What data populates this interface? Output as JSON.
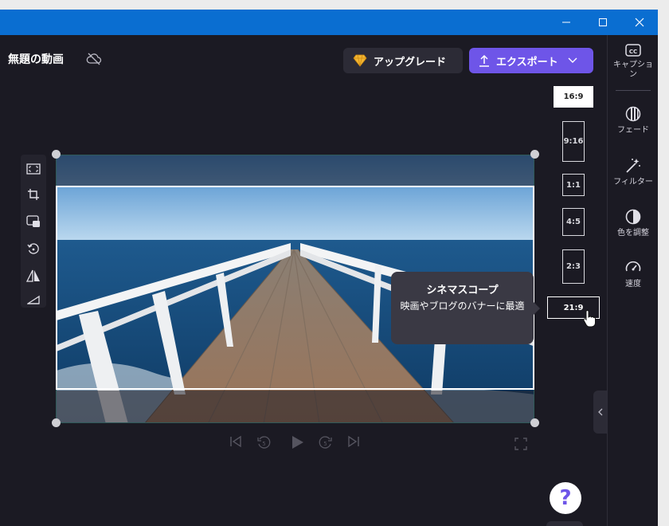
{
  "window": {
    "controls": [
      "minimize-icon",
      "maximize-icon",
      "close-icon"
    ]
  },
  "header": {
    "title": "無題の動画",
    "upgrade_label": "アップグレード",
    "export_label": "エクスポート",
    "accent_color": "#6e55e8"
  },
  "sidebar": {
    "items": [
      {
        "label": "キャプション",
        "icon": "captions-icon"
      },
      {
        "label": "フェード",
        "icon": "fade-icon"
      },
      {
        "label": "フィルター",
        "icon": "filter-wand-icon"
      },
      {
        "label": "色を調整",
        "icon": "color-adjust-icon"
      },
      {
        "label": "速度",
        "icon": "speed-gauge-icon"
      }
    ]
  },
  "aspect_ratios": {
    "options": [
      "16:9",
      "9:16",
      "1:1",
      "4:5",
      "2:3",
      "21:9"
    ],
    "selected": "16:9",
    "hovered": "21:9"
  },
  "tooltip": {
    "title": "シネマスコープ",
    "description": "映画やブログのバナーに最適"
  },
  "tools": [
    "fit-icon",
    "crop-icon",
    "picture-in-picture-icon",
    "rotate-icon",
    "flip-icon",
    "fade-corner-icon"
  ],
  "playback": [
    "skip-back-icon",
    "rewind-5-icon",
    "play-icon",
    "forward-5-icon",
    "skip-forward-icon",
    "fullscreen-icon"
  ],
  "help_label": "?"
}
